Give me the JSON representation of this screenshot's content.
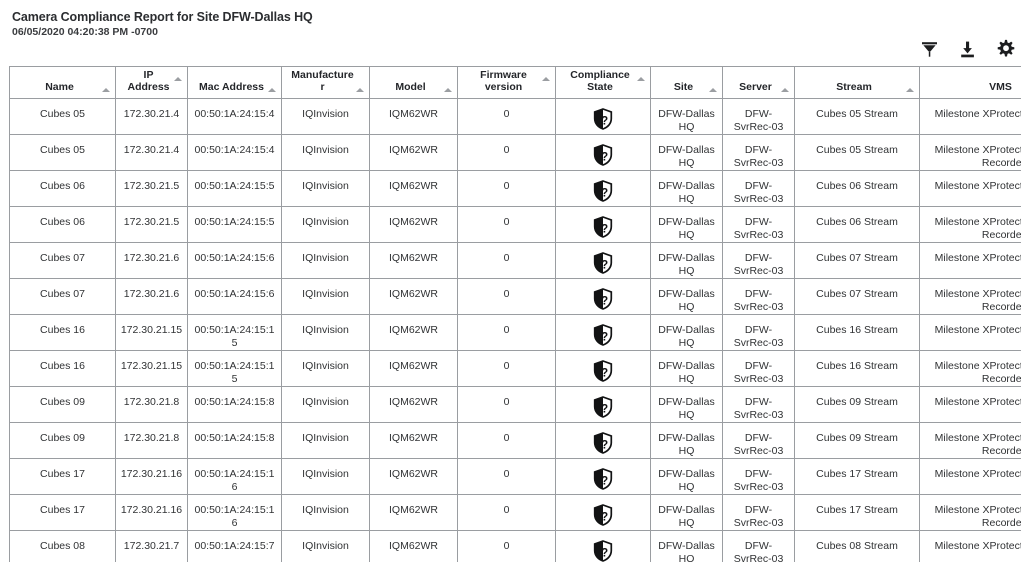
{
  "report": {
    "title": "Camera Compliance Report for Site DFW-Dallas HQ",
    "timestamp": "06/05/2020 04:20:38 PM -0700"
  },
  "toolbar": {
    "filter_label": "Filter",
    "filter_icon": "filter-icon",
    "download_label": "Download",
    "download_icon": "download-icon",
    "settings_label": "Settings",
    "settings_icon": "gear-icon"
  },
  "table": {
    "sort_indicator": "ascending",
    "columns": [
      {
        "key": "name",
        "label": "Name"
      },
      {
        "key": "ip",
        "label": "IP Address"
      },
      {
        "key": "mac",
        "label": "Mac Address"
      },
      {
        "key": "manufacturer",
        "label": "Manufacturer"
      },
      {
        "key": "model",
        "label": "Model"
      },
      {
        "key": "firmware",
        "label": "Firmware version"
      },
      {
        "key": "compliance",
        "label": "Compliance State"
      },
      {
        "key": "site",
        "label": "Site"
      },
      {
        "key": "server",
        "label": "Server"
      },
      {
        "key": "stream",
        "label": "Stream"
      },
      {
        "key": "vms",
        "label": "VMS"
      }
    ],
    "compliance_icon": "shield-question-icon",
    "compliance_state": "Unknown",
    "rows": [
      {
        "name": "Cubes 05",
        "ip": "172.30.21.4",
        "mac": "00:50:1A:24:15:4",
        "manufacturer": "IQInvision",
        "model": "IQM62WR",
        "firmware": "0",
        "compliance": "Unknown",
        "site": "DFW-Dallas HQ",
        "server": "DFW-SvrRec-03",
        "stream": "Cubes 05 Stream",
        "vms": "Milestone XProtect Corporate"
      },
      {
        "name": "Cubes 05",
        "ip": "172.30.21.4",
        "mac": "00:50:1A:24:15:4",
        "manufacturer": "IQInvision",
        "model": "IQM62WR",
        "firmware": "0",
        "compliance": "Unknown",
        "site": "DFW-Dallas HQ",
        "server": "DFW-SvrRec-03",
        "stream": "Cubes 05 Stream",
        "vms": "Milestone XProtect Corporate Recorder"
      },
      {
        "name": "Cubes 06",
        "ip": "172.30.21.5",
        "mac": "00:50:1A:24:15:5",
        "manufacturer": "IQInvision",
        "model": "IQM62WR",
        "firmware": "0",
        "compliance": "Unknown",
        "site": "DFW-Dallas HQ",
        "server": "DFW-SvrRec-03",
        "stream": "Cubes 06 Stream",
        "vms": "Milestone XProtect Corporate"
      },
      {
        "name": "Cubes 06",
        "ip": "172.30.21.5",
        "mac": "00:50:1A:24:15:5",
        "manufacturer": "IQInvision",
        "model": "IQM62WR",
        "firmware": "0",
        "compliance": "Unknown",
        "site": "DFW-Dallas HQ",
        "server": "DFW-SvrRec-03",
        "stream": "Cubes 06 Stream",
        "vms": "Milestone XProtect Corporate Recorder"
      },
      {
        "name": "Cubes 07",
        "ip": "172.30.21.6",
        "mac": "00:50:1A:24:15:6",
        "manufacturer": "IQInvision",
        "model": "IQM62WR",
        "firmware": "0",
        "compliance": "Unknown",
        "site": "DFW-Dallas HQ",
        "server": "DFW-SvrRec-03",
        "stream": "Cubes 07 Stream",
        "vms": "Milestone XProtect Corporate"
      },
      {
        "name": "Cubes 07",
        "ip": "172.30.21.6",
        "mac": "00:50:1A:24:15:6",
        "manufacturer": "IQInvision",
        "model": "IQM62WR",
        "firmware": "0",
        "compliance": "Unknown",
        "site": "DFW-Dallas HQ",
        "server": "DFW-SvrRec-03",
        "stream": "Cubes 07 Stream",
        "vms": "Milestone XProtect Corporate Recorder"
      },
      {
        "name": "Cubes 16",
        "ip": "172.30.21.15",
        "mac": "00:50:1A:24:15:15",
        "manufacturer": "IQInvision",
        "model": "IQM62WR",
        "firmware": "0",
        "compliance": "Unknown",
        "site": "DFW-Dallas HQ",
        "server": "DFW-SvrRec-03",
        "stream": "Cubes 16 Stream",
        "vms": "Milestone XProtect Corporate"
      },
      {
        "name": "Cubes 16",
        "ip": "172.30.21.15",
        "mac": "00:50:1A:24:15:15",
        "manufacturer": "IQInvision",
        "model": "IQM62WR",
        "firmware": "0",
        "compliance": "Unknown",
        "site": "DFW-Dallas HQ",
        "server": "DFW-SvrRec-03",
        "stream": "Cubes 16 Stream",
        "vms": "Milestone XProtect Corporate Recorder"
      },
      {
        "name": "Cubes 09",
        "ip": "172.30.21.8",
        "mac": "00:50:1A:24:15:8",
        "manufacturer": "IQInvision",
        "model": "IQM62WR",
        "firmware": "0",
        "compliance": "Unknown",
        "site": "DFW-Dallas HQ",
        "server": "DFW-SvrRec-03",
        "stream": "Cubes 09 Stream",
        "vms": "Milestone XProtect Corporate"
      },
      {
        "name": "Cubes 09",
        "ip": "172.30.21.8",
        "mac": "00:50:1A:24:15:8",
        "manufacturer": "IQInvision",
        "model": "IQM62WR",
        "firmware": "0",
        "compliance": "Unknown",
        "site": "DFW-Dallas HQ",
        "server": "DFW-SvrRec-03",
        "stream": "Cubes 09 Stream",
        "vms": "Milestone XProtect Corporate Recorder"
      },
      {
        "name": "Cubes 17",
        "ip": "172.30.21.16",
        "mac": "00:50:1A:24:15:16",
        "manufacturer": "IQInvision",
        "model": "IQM62WR",
        "firmware": "0",
        "compliance": "Unknown",
        "site": "DFW-Dallas HQ",
        "server": "DFW-SvrRec-03",
        "stream": "Cubes 17 Stream",
        "vms": "Milestone XProtect Corporate"
      },
      {
        "name": "Cubes 17",
        "ip": "172.30.21.16",
        "mac": "00:50:1A:24:15:16",
        "manufacturer": "IQInvision",
        "model": "IQM62WR",
        "firmware": "0",
        "compliance": "Unknown",
        "site": "DFW-Dallas HQ",
        "server": "DFW-SvrRec-03",
        "stream": "Cubes 17 Stream",
        "vms": "Milestone XProtect Corporate Recorder"
      },
      {
        "name": "Cubes 08",
        "ip": "172.30.21.7",
        "mac": "00:50:1A:24:15:7",
        "manufacturer": "IQInvision",
        "model": "IQM62WR",
        "firmware": "0",
        "compliance": "Unknown",
        "site": "DFW-Dallas HQ",
        "server": "DFW-SvrRec-03",
        "stream": "Cubes 08 Stream",
        "vms": "Milestone XProtect Corporate"
      }
    ]
  }
}
